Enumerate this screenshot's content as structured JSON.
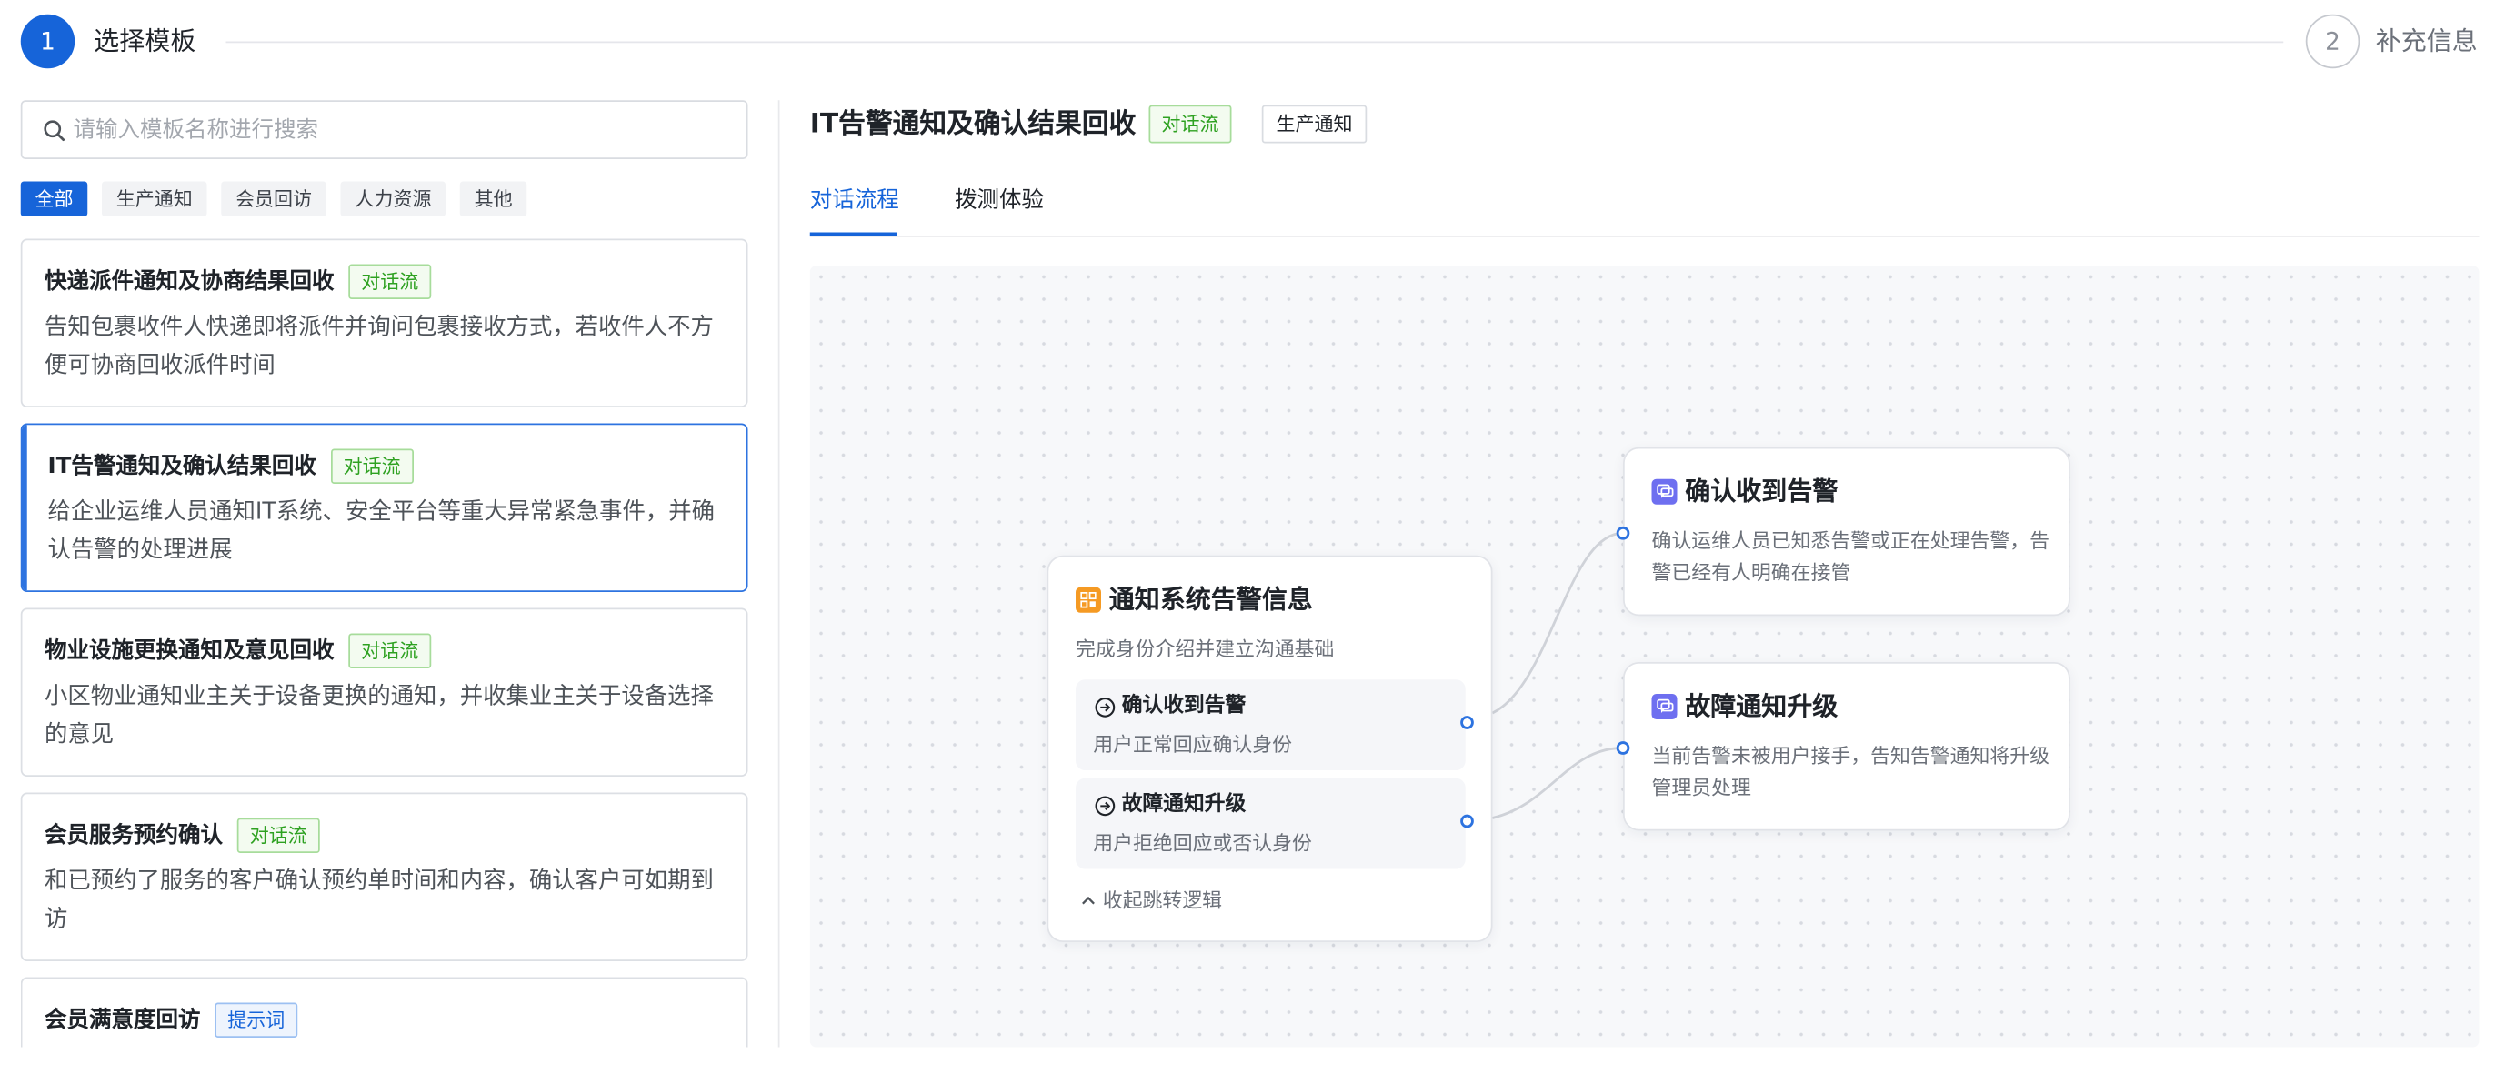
{
  "steps": [
    {
      "number": "1",
      "label": "选择模板"
    },
    {
      "number": "2",
      "label": "补充信息"
    }
  ],
  "search": {
    "placeholder": "请输入模板名称进行搜索"
  },
  "categories": [
    "全部",
    "生产通知",
    "会员回访",
    "人力资源",
    "其他"
  ],
  "templates": [
    {
      "title": "快递派件通知及协商结果回收",
      "tag": "对话流",
      "desc": "告知包裹收件人快递即将派件并询问包裹接收方式，若收件人不方便可协商回收派件时间"
    },
    {
      "title": "IT告警通知及确认结果回收",
      "tag": "对话流",
      "desc": "给企业运维人员通知IT系统、安全平台等重大异常紧急事件，并确认告警的处理进展"
    },
    {
      "title": "物业设施更换通知及意见回收",
      "tag": "对话流",
      "desc": "小区物业通知业主关于设备更换的通知，并收集业主关于设备选择的意见"
    },
    {
      "title": "会员服务预约确认",
      "tag": "对话流",
      "desc": "和已预约了服务的客户确认预约单时间和内容，确认客户可如期到访"
    },
    {
      "title": "会员满意度回访",
      "tag": "提示词",
      "desc": ""
    }
  ],
  "detail": {
    "title": "IT告警通知及确认结果回收",
    "type_tag": "对话流",
    "category_tag": "生产通知",
    "tabs": [
      "对话流程",
      "拨测体验"
    ]
  },
  "flow": {
    "main_node": {
      "title": "通知系统告警信息",
      "subtitle": "完成身份介绍并建立沟通基础",
      "branches": [
        {
          "title": "确认收到告警",
          "desc": "用户正常回应确认身份"
        },
        {
          "title": "故障通知升级",
          "desc": "用户拒绝回应或否认身份"
        }
      ],
      "collapse_label": "收起跳转逻辑"
    },
    "targets": [
      {
        "title": "确认收到告警",
        "desc": "确认运维人员已知悉告警或正在处理告警，告警已经有人明确在接管"
      },
      {
        "title": "故障通知升级",
        "desc": "当前告警未被用户接手，告知告警通知将升级管理员处理"
      }
    ]
  },
  "colors": {
    "primary": "#1664d9",
    "tag_green": "#2ea121",
    "tag_blue": "#1664d9",
    "node_icon_orange": "#f59a23",
    "node_icon_purple": "#6e6ff0",
    "edge_port": "#2d73e0"
  },
  "icons": {
    "search": "search-icon",
    "main_node": "node-grid-icon",
    "branch": "arrow-right-circle-icon",
    "target_node": "chat-icon",
    "collapse": "chevron-up-icon"
  }
}
